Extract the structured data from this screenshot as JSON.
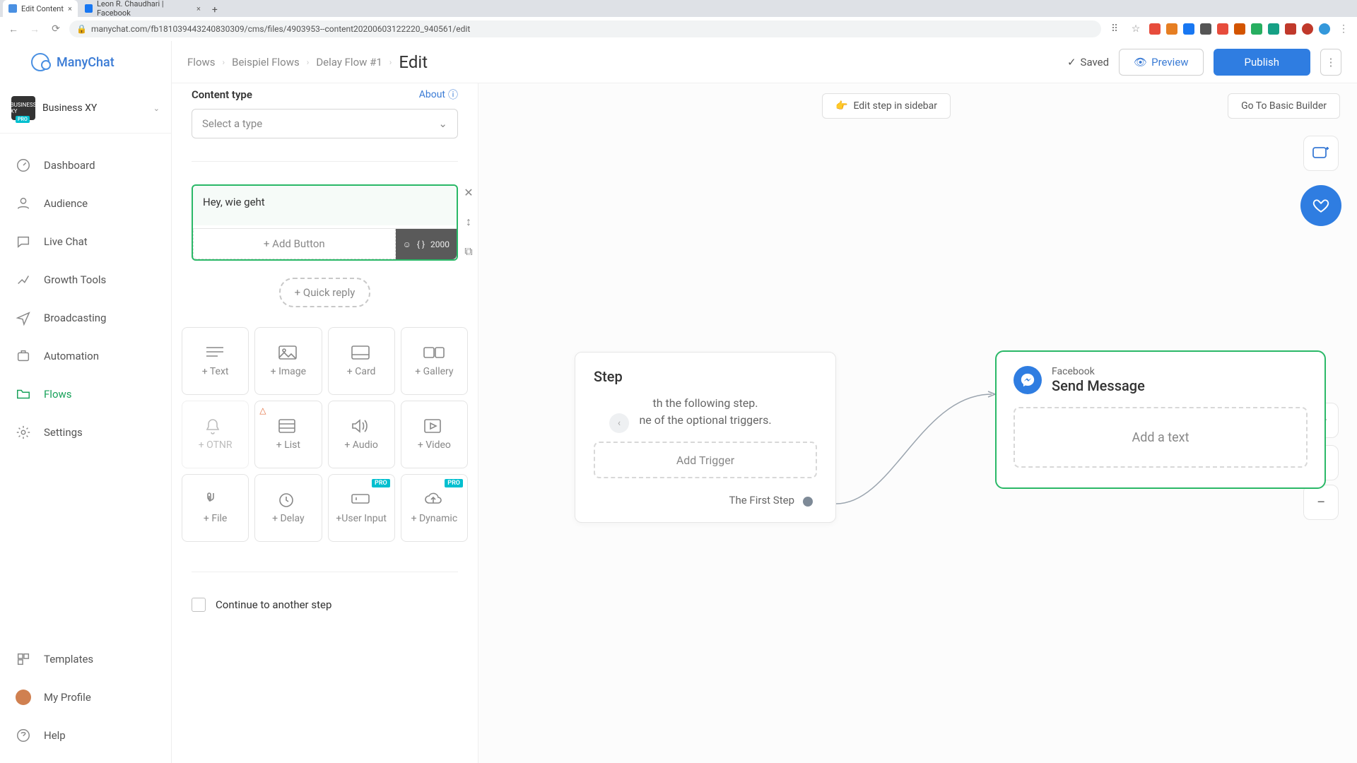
{
  "browser": {
    "tabs": [
      {
        "title": "Edit Content",
        "active": true
      },
      {
        "title": "Leon R. Chaudhari | Facebook",
        "active": false
      }
    ],
    "url": "manychat.com/fb181039443240830309/cms/files/4903953--content20200603122220_940561/edit"
  },
  "brand": "ManyChat",
  "workspace": {
    "name": "Business XY",
    "pro": "PRO",
    "avatar_text": "BUSINESS XY"
  },
  "nav": {
    "items": [
      {
        "id": "dashboard",
        "label": "Dashboard"
      },
      {
        "id": "audience",
        "label": "Audience"
      },
      {
        "id": "livechat",
        "label": "Live Chat"
      },
      {
        "id": "growth",
        "label": "Growth Tools"
      },
      {
        "id": "broadcasting",
        "label": "Broadcasting"
      },
      {
        "id": "automation",
        "label": "Automation"
      },
      {
        "id": "flows",
        "label": "Flows"
      },
      {
        "id": "settings",
        "label": "Settings"
      }
    ],
    "active": "flows",
    "bottom": [
      {
        "id": "templates",
        "label": "Templates"
      },
      {
        "id": "profile",
        "label": "My Profile"
      },
      {
        "id": "help",
        "label": "Help"
      }
    ]
  },
  "breadcrumbs": [
    "Flows",
    "Beispiel Flows",
    "Delay Flow #1"
  ],
  "page_title": "Edit",
  "top": {
    "saved": "Saved",
    "preview": "Preview",
    "publish": "Publish"
  },
  "canvas": {
    "edit_sidebar_chip": "Edit step in sidebar",
    "basic_builder_chip": "Go To Basic Builder",
    "starting_step": {
      "title": "Step",
      "line1": "th the following step.",
      "line2": "ne of the optional triggers.",
      "add_trigger": "Add Trigger",
      "first_step": "The First Step"
    },
    "fb_card": {
      "sub": "Facebook",
      "title": "Send Message",
      "addtext": "Add a text"
    }
  },
  "editor": {
    "title": "Send Message",
    "content_type_label": "Content type",
    "about": "About",
    "select_placeholder": "Select a type",
    "message_value": "Hey, wie geht",
    "char_limit": "2000",
    "add_button": "+ Add Button",
    "quick_reply": "+ Quick reply",
    "blocks": [
      {
        "label": "+ Text",
        "icon": "lines"
      },
      {
        "label": "+ Image",
        "icon": "image"
      },
      {
        "label": "+ Card",
        "icon": "card"
      },
      {
        "label": "+ Gallery",
        "icon": "gallery"
      },
      {
        "label": "+ OTNR",
        "icon": "bell",
        "disabled": true
      },
      {
        "label": "+ List",
        "icon": "list",
        "warn": true
      },
      {
        "label": "+ Audio",
        "icon": "audio"
      },
      {
        "label": "+ Video",
        "icon": "video"
      },
      {
        "label": "+ File",
        "icon": "file"
      },
      {
        "label": "+ Delay",
        "icon": "clock"
      },
      {
        "label": "+User Input",
        "icon": "input",
        "pro": true
      },
      {
        "label": "+ Dynamic",
        "icon": "cloud",
        "pro": true
      }
    ],
    "continue": "Continue to another step"
  },
  "colors": {
    "accent_green": "#2ab867",
    "accent_blue": "#2f7de1"
  }
}
